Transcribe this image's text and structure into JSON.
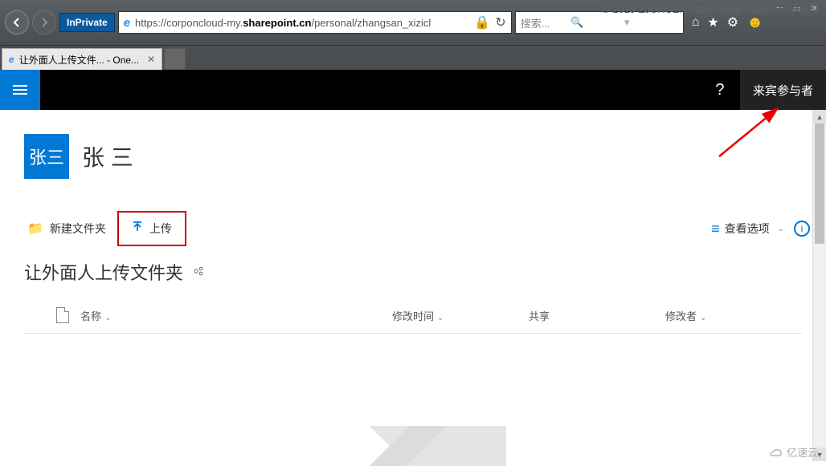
{
  "watermark": {
    "top": "© 2019 ZJUNSEN https://blog.51cto.com/rdsrv",
    "bottom": "亿速云"
  },
  "browser": {
    "inprivate_label": "InPrivate",
    "url_prefix": "https://corponcloud-my.",
    "url_bold": "sharepoint.cn",
    "url_suffix": "/personal/zhangsan_xizicl",
    "search_placeholder": "搜索...",
    "tab_title": "让外面人上传文件... - One...",
    "tab_favicon": "e"
  },
  "sp_header": {
    "help": "?",
    "guest_label": "来宾参与者"
  },
  "site": {
    "logo_text": "张三",
    "title": "张 三"
  },
  "command_bar": {
    "new_folder": "新建文件夹",
    "upload": "上传",
    "view_options": "查看选项"
  },
  "folder": {
    "title": "让外面人上传文件夹"
  },
  "table": {
    "columns": {
      "name": "名称",
      "modified": "修改时间",
      "share": "共享",
      "author": "修改者"
    }
  }
}
